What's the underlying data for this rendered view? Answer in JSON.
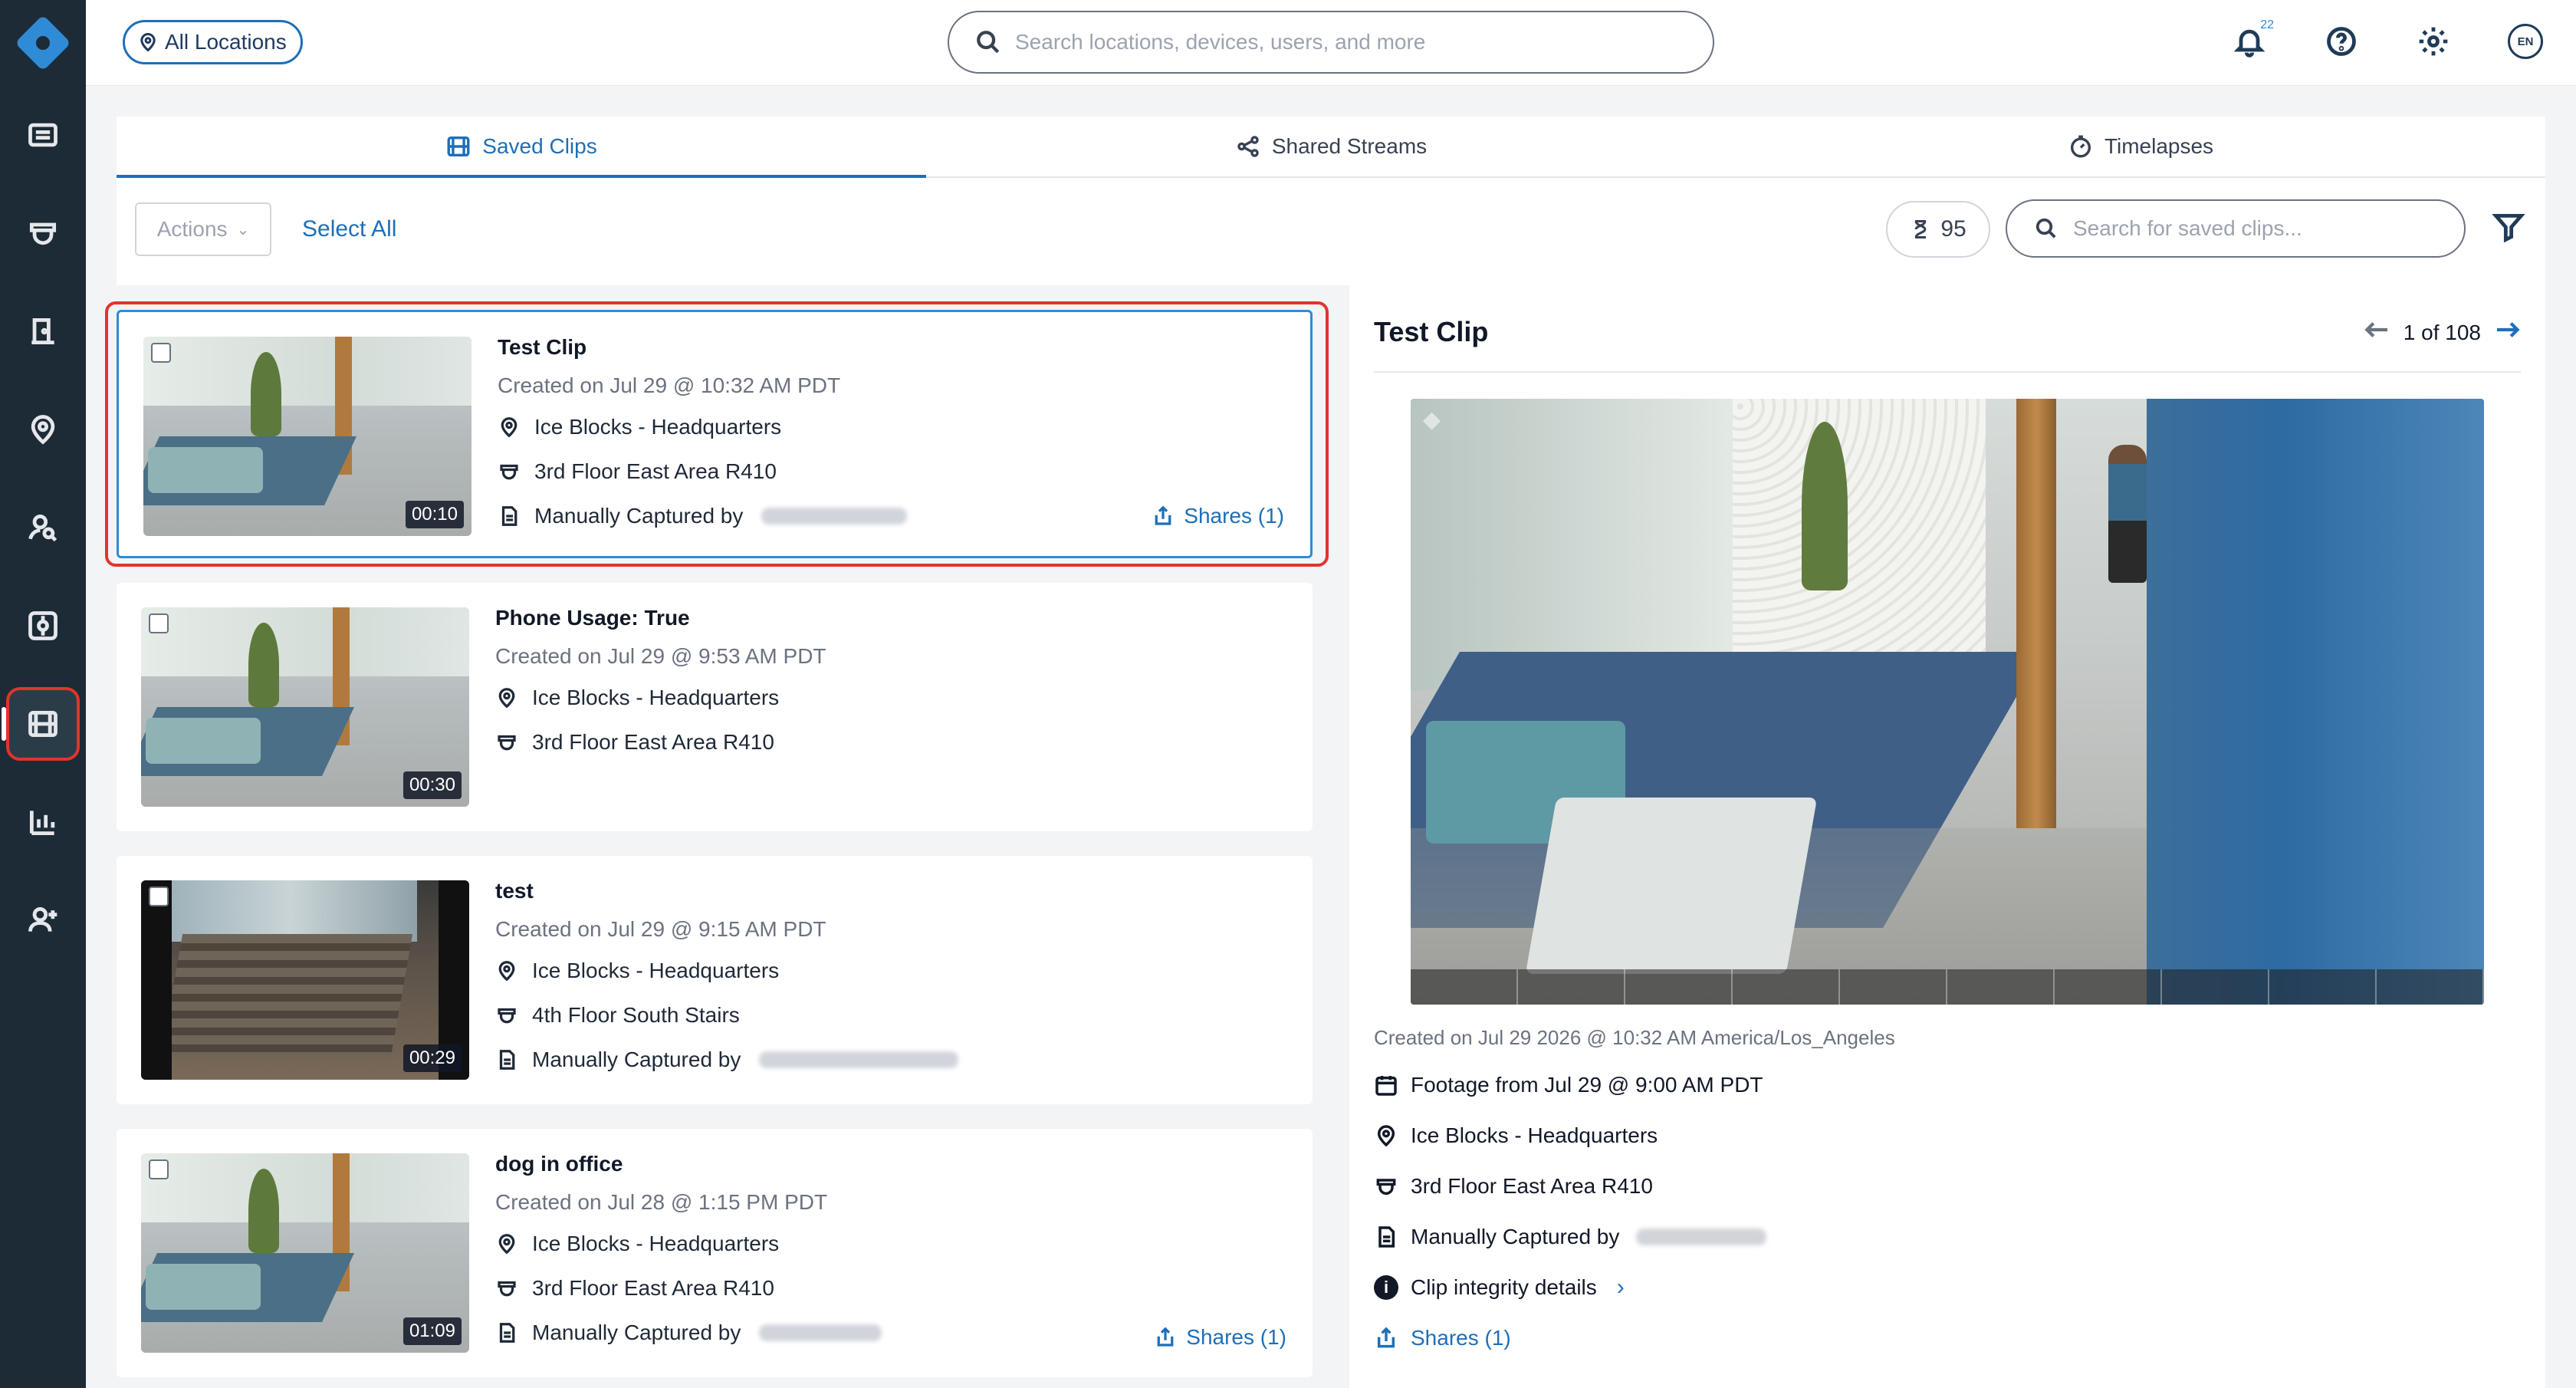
{
  "topbar": {
    "location_label": "All Locations",
    "search_placeholder": "Search locations, devices, users, and more",
    "notification_count": "22",
    "language": "EN"
  },
  "tabs": [
    {
      "label": "Saved Clips",
      "active": true
    },
    {
      "label": "Shared Streams",
      "active": false
    },
    {
      "label": "Timelapses",
      "active": false
    }
  ],
  "toolbar": {
    "actions_label": "Actions",
    "select_all_label": "Select All",
    "count": "95",
    "search_placeholder": "Search for saved clips..."
  },
  "clips": [
    {
      "title": "Test Clip",
      "created": "Created on Jul 29 @ 10:32 AM PDT",
      "location": "Ice Blocks - Headquarters",
      "camera": "3rd Floor East Area R410",
      "captured_label": "Manually Captured by",
      "duration": "00:10",
      "shares": "Shares (1)"
    },
    {
      "title": "Phone Usage: True",
      "created": "Created on Jul 29 @ 9:53 AM PDT",
      "location": "Ice Blocks - Headquarters",
      "camera": "3rd Floor East Area R410",
      "duration": "00:30"
    },
    {
      "title": "test",
      "created": "Created on Jul 29 @ 9:15 AM PDT",
      "location": "Ice Blocks - Headquarters",
      "camera": "4th Floor South Stairs",
      "captured_label": "Manually Captured by",
      "duration": "00:29"
    },
    {
      "title": "dog in office",
      "created": "Created on Jul 28 @ 1:15 PM PDT",
      "location": "Ice Blocks - Headquarters",
      "camera": "3rd Floor East Area R410",
      "captured_label": "Manually Captured by",
      "duration": "01:09",
      "shares": "Shares (1)"
    }
  ],
  "detail": {
    "title": "Test Clip",
    "pager": "1 of 108",
    "created": "Created on Jul 29 2026 @ 10:32 AM America/Los_Angeles",
    "footage": "Footage from Jul 29 @ 9:00 AM PDT",
    "location": "Ice Blocks - Headquarters",
    "camera": "3rd Floor East Area R410",
    "captured_label": "Manually Captured by",
    "integrity": "Clip integrity details",
    "shares": "Shares (1)"
  },
  "colors": {
    "sidebar": "#1c2b36",
    "accent": "#1e6fb8",
    "highlight": "#e0352b"
  }
}
